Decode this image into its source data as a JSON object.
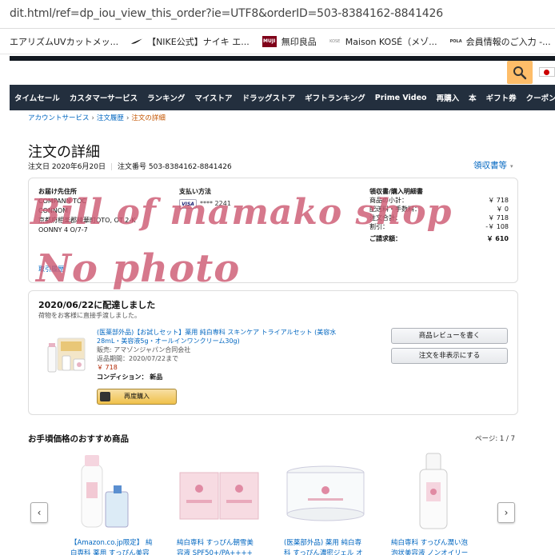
{
  "browser": {
    "url": "dit.html/ref=dp_iou_view_this_order?ie=UTF8&orderID=503-8384162-8841426",
    "bookmarks": [
      {
        "label": "エアリズムUVカットメッ...",
        "icon": "blank-icon"
      },
      {
        "label": "【NIKE公式】ナイキ エ...",
        "icon": "nike-swoosh-icon"
      },
      {
        "label": "無印良品",
        "icon": "muji-logo-icon",
        "icon_text": "MUJI"
      },
      {
        "label": "Maison KOSÉ（メゾ...",
        "icon": "kose-logo-icon",
        "icon_text": "KOSE"
      },
      {
        "label": "会員情報のご入力 -...",
        "icon": "pola-logo-icon",
        "icon_text": "POLA"
      }
    ]
  },
  "nav": {
    "items": [
      "タイムセール",
      "カスタマーサービス",
      "ランキング",
      "マイストア",
      "ドラッグストア",
      "ギフトランキング",
      "Prime Video",
      "再購入",
      "本",
      "ギフト券",
      "クーポン"
    ]
  },
  "breadcrumb": {
    "items": [
      "アカウントサービス",
      "注文履歴"
    ],
    "current": "注文の詳細",
    "separator": "›"
  },
  "order": {
    "title": "注文の詳細",
    "date": "注文日 2020年6月20日",
    "number": "注文番号 503-8384162-8841426",
    "invoice_link": "領収書等",
    "shipping_heading": "お届け先住所",
    "shipping_lines": [
      "COMPANN TOC",
      "CONNOM",
      "京都府相楽郡精華町OTO, OT 2-K",
      "OONNY 4 O/7-7"
    ],
    "payment_heading": "支払い方法",
    "card_brand": "VISA",
    "card_number": "**** 2241",
    "totals_heading": "領収書/購入明細書",
    "totals": [
      {
        "label": "商品の小計：",
        "value": "￥ 718"
      },
      {
        "label": "配送料・手数料：",
        "value": "￥ 0"
      },
      {
        "label": "注文合計：",
        "value": "￥ 718"
      },
      {
        "label": "割引：",
        "value": "-￥ 108"
      }
    ],
    "grand_total_label": "ご請求額：",
    "grand_total": "￥ 610",
    "history_link": "取引履歴"
  },
  "shipment": {
    "title": "2020/06/22に配達しました",
    "subtitle": "荷物をお客様に直接手渡しました。",
    "product_title": "(医薬部外品)【お試しセット】薬用 純白専科 スキンケア トライアルセット (美容水 28mL・美容液5g・オールインワンクリーム30g)",
    "seller": "販売: アマゾンジャパン合同会社",
    "return_period": "返品期間：2020/07/22まで",
    "price": "￥ 718",
    "condition": "コンディション： 新品",
    "buy_again": "再度購入",
    "review_button": "商品レビューを書く",
    "hide_button": "注文を非表示にする"
  },
  "recommendations": {
    "title": "お手頃価格のおすすめ商品",
    "page": "ページ: 1 / 7",
    "items": [
      {
        "line1": "【Amazon.co.jp限定】 純",
        "line2": "白専科 薬用 すっぴん美容"
      },
      {
        "line1": "純白専科 すっぴん朝雪美",
        "line2": "容液 SPF50+/PA++++"
      },
      {
        "line1": "(医薬部外品) 薬用 純白専",
        "line2": "科 すっぴん濃密ジェル オ"
      },
      {
        "line1": "純白専科 すっぴん潤い泡",
        "line2": "泡状美容液 ノンオイリー"
      }
    ]
  },
  "watermark": {
    "line1": "Bill of mamako shop",
    "line2": "No photo",
    "color": "#cd5a73"
  },
  "colors": {
    "link": "#0066c0",
    "nav_bg": "#232f3e",
    "search_button": "#febd69",
    "price": "#b12704"
  }
}
